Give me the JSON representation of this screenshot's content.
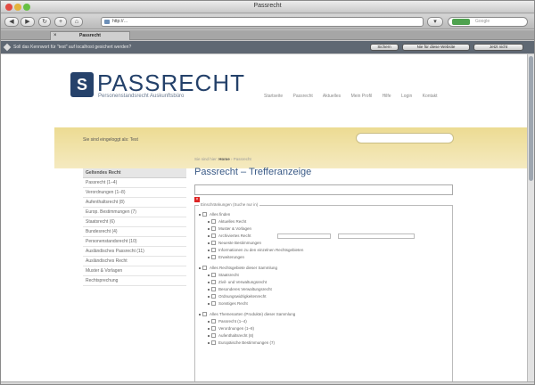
{
  "browser": {
    "window_title": "Passrecht",
    "url": "http://…",
    "search_placeholder": "Google",
    "tab_title": "Passrecht",
    "tab_close": "×",
    "nav_back": "◀",
    "nav_forward": "▶",
    "reload": "↻",
    "add_tab": "+",
    "infobar_text": "Soll das Kennwort für \"test\" auf localhost gesichert werden?",
    "infobar_buttons": [
      "Sichern",
      "Nie für diese Website",
      "Jetzt nicht"
    ]
  },
  "site": {
    "logo_letter": "S",
    "logo_text": "PASSRECHT",
    "logo_subtitle": "Personenstandsrecht Auskunftsbüro",
    "top_nav": [
      "Startseite",
      "Passrecht",
      "Aktuelles",
      "Mein Profil",
      "Hilfe",
      "Login",
      "Kontakt"
    ],
    "band_text": "Sie sind eingeloggt als: Test",
    "breadcrumb_prefix": "Sie sind hier:",
    "breadcrumb_home": "Home",
    "breadcrumb_current": "Passrecht",
    "page_title": "Passrecht – Trefferanzeige",
    "error_mark": "×",
    "filter_legend": "Einschränkungen (Suche nur in)"
  },
  "sidebar": {
    "items": [
      "Geltendes Recht",
      "Passrecht (1–4)",
      "Verordnungen (1–8)",
      "Aufenthaltsrecht (8)",
      "Europ. Bestimmungen (7)",
      "Staatsrecht (6)",
      "Bundesrecht (4)",
      "Personenstandsrecht (10)",
      "Ausländisches Passrecht (11)",
      "Ausländisches Recht",
      "Muster & Vorlagen",
      "Rechtsprechung"
    ]
  },
  "tree": [
    {
      "level": 0,
      "label": "Alles finden"
    },
    {
      "level": 1,
      "label": "Aktuelles Recht"
    },
    {
      "level": 1,
      "label": "Muster & Vorlagen"
    },
    {
      "level": 1,
      "label": "Archiviertes Recht",
      "has_inputs": true
    },
    {
      "level": 1,
      "label": "Neueste Bestimmungen"
    },
    {
      "level": 1,
      "label": "Informationen zu den einzelnen Rechtsgebieten"
    },
    {
      "level": 1,
      "label": "Erweiterungen"
    },
    {
      "level": 0,
      "label": "Alles Rechtsgebiete dieser Sammlung",
      "gap": true
    },
    {
      "level": 1,
      "label": "Staatsrecht"
    },
    {
      "level": 1,
      "label": "Zivil- und Verwaltungsrecht"
    },
    {
      "level": 1,
      "label": "Besonderes Verwaltungsrecht"
    },
    {
      "level": 1,
      "label": "Ordnungswidrigkeitenrecht"
    },
    {
      "level": 1,
      "label": "Sonstiges Recht"
    },
    {
      "level": 0,
      "label": "Alles Themenarten (Produkte) dieser Sammlung",
      "gap": true
    },
    {
      "level": 1,
      "label": "Passrecht (1–4)"
    },
    {
      "level": 1,
      "label": "Verordnungen (1–8)"
    },
    {
      "level": 1,
      "label": "Aufenthaltsrecht (8)"
    },
    {
      "level": 1,
      "label": "Europäische Bestimmungen (7)"
    }
  ]
}
